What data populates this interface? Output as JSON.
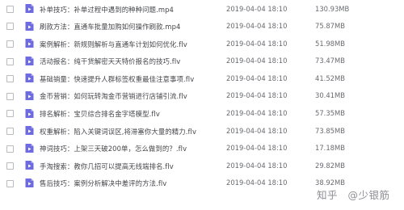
{
  "files": [
    {
      "name": "补单技巧：补单过程中遇到的种种问题.mp4",
      "date": "2019-04-04 18:10",
      "size": "130.93MB"
    },
    {
      "name": "刷款方法：直通车批量加购如何操作刷款.mp4",
      "date": "2019-04-04 18:10",
      "size": "75.87MB"
    },
    {
      "name": "案例解析：新规则解析与直通车计划如何优化.flv",
      "date": "2019-04-04 18:10",
      "size": "51.98MB"
    },
    {
      "name": "活动报名：纯干货解密天天特价报名的技巧.flv",
      "date": "2019-04-04 18:10",
      "size": "73.47MB"
    },
    {
      "name": "基础销量：快速提升人群标签权重最佳注意事项.flv",
      "date": "2019-04-04 18:10",
      "size": "41.52MB"
    },
    {
      "name": "金币营销：如何玩转淘金币营销进行店铺引流.flv",
      "date": "2019-04-04 18:10",
      "size": "30.41MB"
    },
    {
      "name": "排名解析：宝贝综合排名金字塔模型.flv",
      "date": "2019-04-04 18:10",
      "size": "57.35MB"
    },
    {
      "name": "权重解析：陷入关键词误区,将滞塞你大量的精力.flv",
      "date": "2019-04-04 18:10",
      "size": "73.85MB"
    },
    {
      "name": "神词技巧：上架三天破200单，怎么做到的？.flv",
      "date": "2019-04-04 18:10",
      "size": "17.18MB"
    },
    {
      "name": "手淘搜索：教你几招可以提高无线端排名.flv",
      "date": "2019-04-04 18:10",
      "size": "29.82MB"
    },
    {
      "name": "售后技巧：案例分析解决中差评的方法.flv",
      "date": "2019-04-04 18:10",
      "size": "38.92MB"
    }
  ],
  "watermark": {
    "site": "知乎",
    "author": "@少银筋"
  },
  "colors": {
    "file_icon": "#6e6be0",
    "checkbox_border": "#b9b9c0"
  },
  "icons": {
    "file": "video-file-icon",
    "checkbox": "checkbox-icon"
  }
}
